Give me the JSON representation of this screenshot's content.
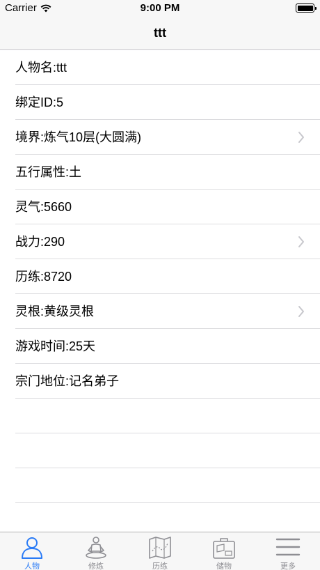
{
  "status_bar": {
    "carrier": "Carrier",
    "time": "9:00 PM"
  },
  "nav": {
    "title": "ttt"
  },
  "rows": [
    {
      "label": "人物名:ttt",
      "disclosure": false
    },
    {
      "label": "绑定ID:5",
      "disclosure": false
    },
    {
      "label": "境界:炼气10层(大圆满)",
      "disclosure": true
    },
    {
      "label": "五行属性:土",
      "disclosure": false
    },
    {
      "label": "灵气:5660",
      "disclosure": false
    },
    {
      "label": "战力:290",
      "disclosure": true
    },
    {
      "label": "历练:8720",
      "disclosure": false
    },
    {
      "label": "灵根:黄级灵根",
      "disclosure": true
    },
    {
      "label": "游戏时间:25天",
      "disclosure": false
    },
    {
      "label": "宗门地位:记名弟子",
      "disclosure": false
    }
  ],
  "tabs": [
    {
      "label": "人物",
      "icon": "person-icon",
      "active": true
    },
    {
      "label": "修炼",
      "icon": "meditation-icon",
      "active": false
    },
    {
      "label": "历练",
      "icon": "map-icon",
      "active": false
    },
    {
      "label": "储物",
      "icon": "storage-icon",
      "active": false
    },
    {
      "label": "更多",
      "icon": "menu-icon",
      "active": false
    }
  ],
  "colors": {
    "accent": "#2a7bf6",
    "inactive": "#8e8e93",
    "separator": "#dcdcdf",
    "bar_background": "#f7f7f7"
  }
}
